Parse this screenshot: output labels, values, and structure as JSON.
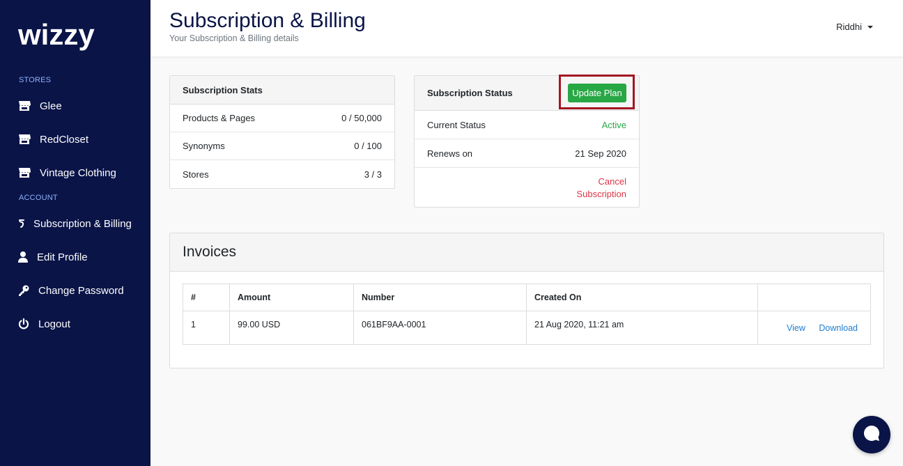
{
  "brand": {
    "name": "wizzy"
  },
  "sidebar": {
    "stores_label": "STORES",
    "account_label": "ACCOUNT",
    "stores": [
      {
        "label": "Glee",
        "icon": "store-icon"
      },
      {
        "label": "RedCloset",
        "icon": "store-icon"
      },
      {
        "label": "Vintage Clothing",
        "icon": "store-icon"
      }
    ],
    "account": [
      {
        "label": "Subscription & Billing",
        "icon": "billing-icon"
      },
      {
        "label": "Edit Profile",
        "icon": "user-icon"
      },
      {
        "label": "Change Password",
        "icon": "key-icon"
      },
      {
        "label": "Logout",
        "icon": "power-icon"
      }
    ]
  },
  "header": {
    "title": "Subscription & Billing",
    "subtitle": "Your Subscription & Billing details",
    "user": "Riddhi"
  },
  "stats": {
    "title": "Subscription Stats",
    "rows": [
      {
        "label": "Products & Pages",
        "value": "0 / 50,000"
      },
      {
        "label": "Synonyms",
        "value": "0 / 100"
      },
      {
        "label": "Stores",
        "value": "3 / 3"
      }
    ]
  },
  "status": {
    "title": "Subscription Status",
    "update_label": "Update Plan",
    "current_status_label": "Current Status",
    "current_status_value": "Active",
    "renews_label": "Renews on",
    "renews_value": "21 Sep 2020",
    "cancel_label": "Cancel Subscription"
  },
  "invoices": {
    "title": "Invoices",
    "columns": [
      "#",
      "Amount",
      "Number",
      "Created On",
      ""
    ],
    "rows": [
      {
        "index": "1",
        "amount": "99.00 USD",
        "number": "061BF9AA-0001",
        "created_on": "21 Aug 2020, 11:21 am",
        "view": "View",
        "download": "Download"
      }
    ]
  },
  "colors": {
    "sidebar_bg": "#0a1447",
    "accent_green": "#28a745",
    "danger": "#dc3545",
    "link": "#1f7ed0",
    "highlight": "#a31621"
  }
}
